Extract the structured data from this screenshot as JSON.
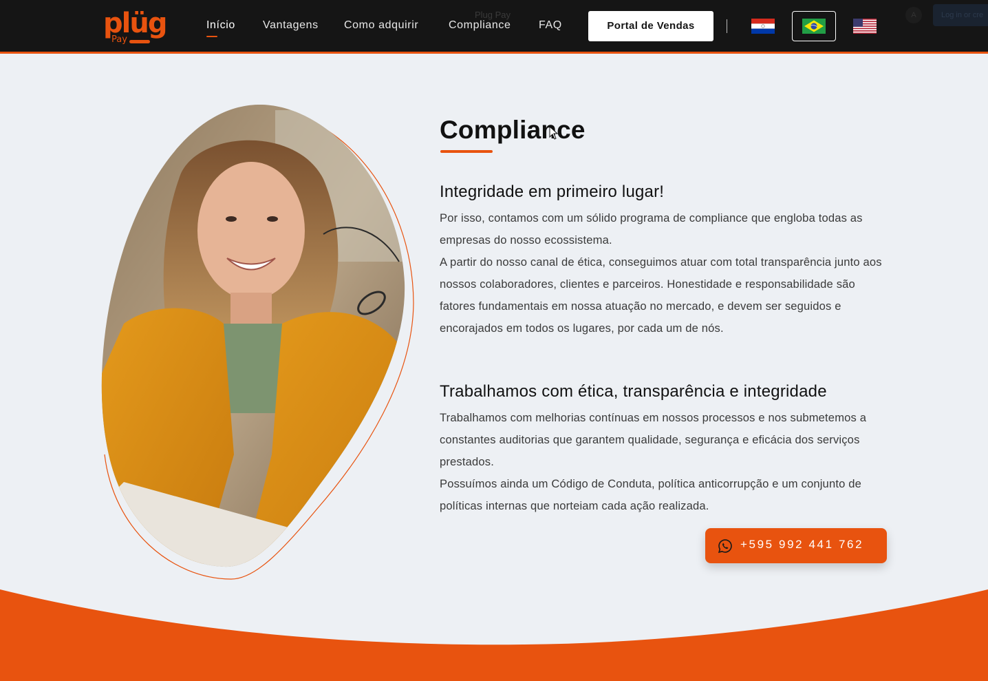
{
  "header": {
    "logo": {
      "brand": "plüg",
      "sub": "Pay"
    },
    "nav": [
      {
        "label": "Início",
        "active": true
      },
      {
        "label": "Vantagens",
        "active": false
      },
      {
        "label": "Como adquirir",
        "active": false
      },
      {
        "label": "Compliance",
        "active": false
      },
      {
        "label": "FAQ",
        "active": false
      }
    ],
    "ghost_title": "Plug Pay",
    "portal_button": "Portal de Vendas",
    "languages": [
      {
        "icon": "paraguay-flag-icon"
      },
      {
        "icon": "brazil-flag-icon",
        "selected": true
      },
      {
        "icon": "usa-flag-icon"
      }
    ],
    "ghost_avatar": "A",
    "ghost_login": "Log in or cre"
  },
  "colors": {
    "accent": "#e8530f",
    "header_bg": "#151515",
    "page_bg": "#edf0f4"
  },
  "content": {
    "title": "Compliance",
    "section1": {
      "heading": "Integridade em primeiro lugar!",
      "paragraphs": [
        "Por isso, contamos com um sólido programa de compliance que engloba todas as empresas do nosso ecossistema.",
        "A partir do nosso canal de ética, conseguimos atuar com total transparência junto aos nossos colaboradores, clientes e parceiros. Honestidade e responsabilidade são fatores fundamentais em nossa atuação no mercado, e devem ser seguidos e encorajados em todos os lugares, por cada um de nós."
      ]
    },
    "section2": {
      "heading": "Trabalhamos com ética, transparência e integridade",
      "paragraphs": [
        "Trabalhamos com melhorias contínuas em nossos processos e nos submetemos a constantes auditorias que garantem qualidade, segurança e eficácia dos serviços prestados.",
        "Possuímos ainda um Código de Conduta, política anticorrupção e um conjunto de políticas internas que norteiam cada ação realizada."
      ]
    }
  },
  "whatsapp": {
    "icon": "whatsapp-icon",
    "phone": "+595 992 441 762"
  }
}
